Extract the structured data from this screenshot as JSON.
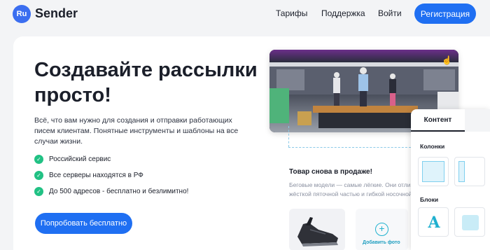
{
  "header": {
    "logo_badge": "Ru",
    "logo_text": "Sender",
    "nav": [
      "Тарифы",
      "Поддержка",
      "Войти"
    ],
    "register_label": "Регистрация"
  },
  "hero": {
    "title": "Создавайте рассылки просто!",
    "description": "Всё, что вам нужно для создания и отправки работающих писем клиентам. Понятные инструменты и шаблоны на все случаи жизни.",
    "features": [
      "Российский сервис",
      "Все серверы находятся в РФ",
      "До 500 адресов - бесплатно и безлимитно!"
    ],
    "cta_label": "Попробовать бесплатно"
  },
  "editor": {
    "newsletter_title": "Товар снова в продаже!",
    "newsletter_text_1": "Беговые модели — самые лёгкие. Они отличаются",
    "newsletter_text_2": "жёсткой пяточной частью и гибкой носочной",
    "add_photo_label": "Добавить фото",
    "panel_tab": "Контент",
    "columns_heading": "Колонки",
    "blocks_heading": "Блоки"
  },
  "colors": {
    "accent": "#1f6ff2",
    "check": "#21c184",
    "teal": "#21b2cf"
  }
}
